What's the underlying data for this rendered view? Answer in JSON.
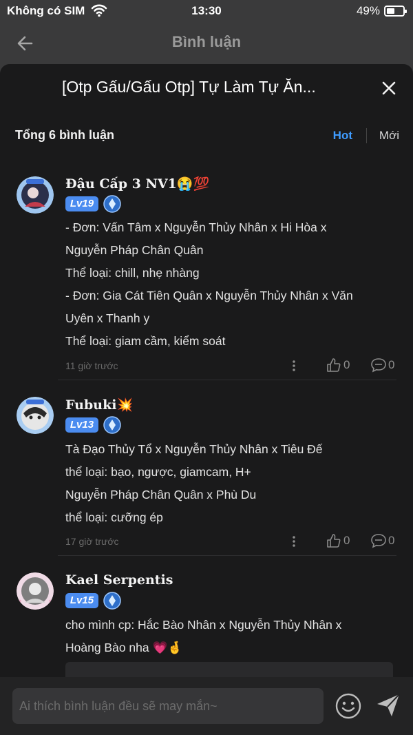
{
  "status_bar": {
    "carrier": "Không có SIM",
    "time": "13:30",
    "battery": "49%"
  },
  "top_bar": {
    "title": "Bình luận"
  },
  "sheet": {
    "title": "[Otp Gấu/Gấu Otp] Tự Làm Tự Ăn...",
    "count_label": "Tổng 6 bình luận",
    "sort": {
      "hot": "Hot",
      "new": "Mới"
    }
  },
  "comments": [
    {
      "author": "Đậu Cấp 3 NV1😭💯",
      "level": "Lv19",
      "lines": [
        "- Đơn: Vấn Tâm x Nguyễn Thủy Nhân x Hi Hòa x",
        "Nguyễn Pháp Chân Quân",
        "Thể loại: chill, nhẹ nhàng",
        " - Đơn: Gia Cát Tiên Quân x Nguyễn Thủy Nhân x Văn",
        "Uyên x Thanh y",
        "Thể loại: giam cầm, kiểm soát"
      ],
      "time": "11 giờ trước",
      "likes": "0",
      "replies": "0"
    },
    {
      "author": "Fubuki💥",
      "level": "Lv13",
      "lines": [
        "Tà Đạo Thủy Tổ x Nguyễn Thủy Nhân x Tiêu Đế",
        "thể loại: bạo, ngược, giamcam, H+",
        "Nguyễn Pháp Chân Quân x Phù Du",
        "thể loại: cưỡng ép"
      ],
      "time": "17 giờ trước",
      "likes": "0",
      "replies": "0"
    },
    {
      "author": "Kael Serpentis",
      "level": "Lv15",
      "lines": [
        "cho mình cp: Hắc Bào Nhân x Nguyễn Thủy Nhân x",
        "Hoàng Bào nha 💗🤞"
      ]
    }
  ],
  "input": {
    "placeholder": "Ai thích bình luận đều sẽ may mắn~"
  },
  "colors": {
    "accent": "#3f9cff",
    "badge": "#4b8cf0",
    "sheet_bg": "#1a1a1b",
    "page_bg": "#3a3a3b"
  }
}
